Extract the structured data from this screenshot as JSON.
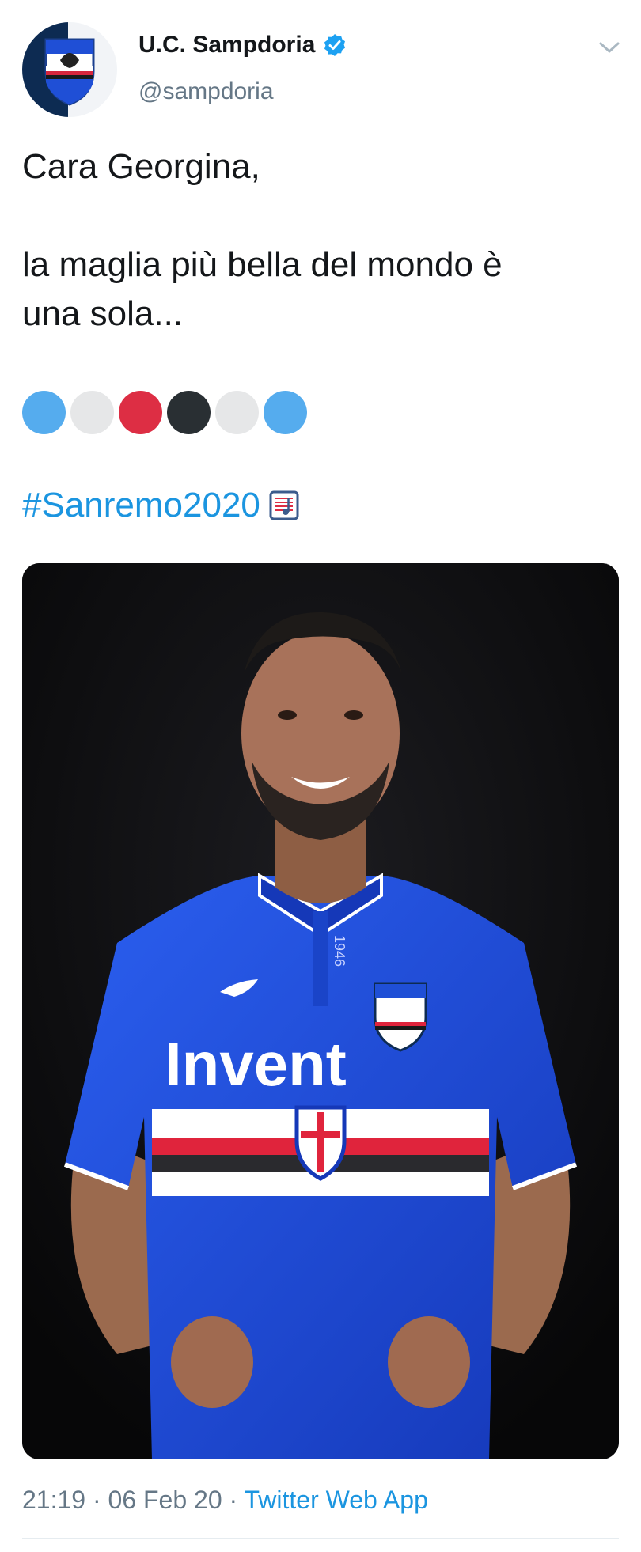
{
  "tweet": {
    "author_name": "U.C. Sampdoria",
    "handle": "@sampdoria",
    "lines": {
      "greeting": "Cara Georgina,",
      "line1": "la maglia più bella del mondo è",
      "line2": "una sola..."
    },
    "color_dots": [
      "#55acee",
      "#e6e7e8",
      "#dd2e44",
      "#292f33",
      "#e6e7e8",
      "#55acee"
    ],
    "hashtag": "#Sanremo2020",
    "hashtag_icon": "musical-score-icon",
    "photo": {
      "shirt_sponsor": "Invent",
      "collar_year": "1946",
      "brand_accent": "#1f4fd6"
    },
    "time": "21:19",
    "separator": "·",
    "date": "06 Feb 20",
    "source": "Twitter Web App"
  },
  "icons": {
    "verified": "verified-badge-icon",
    "more": "chevron-down-icon"
  },
  "colors": {
    "link": "#1b95e0",
    "secondary_text": "#657786",
    "verified": "#1da1f2"
  }
}
